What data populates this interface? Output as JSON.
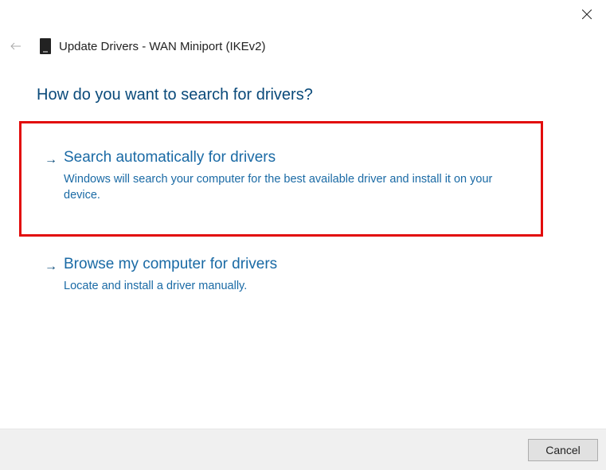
{
  "window": {
    "title": "Update Drivers - WAN Miniport (IKEv2)"
  },
  "main": {
    "question": "How do you want to search for drivers?"
  },
  "options": [
    {
      "title": "Search automatically for drivers",
      "description": "Windows will search your computer for the best available driver and install it on your device."
    },
    {
      "title": "Browse my computer for drivers",
      "description": "Locate and install a driver manually."
    }
  ],
  "footer": {
    "cancel_label": "Cancel"
  }
}
